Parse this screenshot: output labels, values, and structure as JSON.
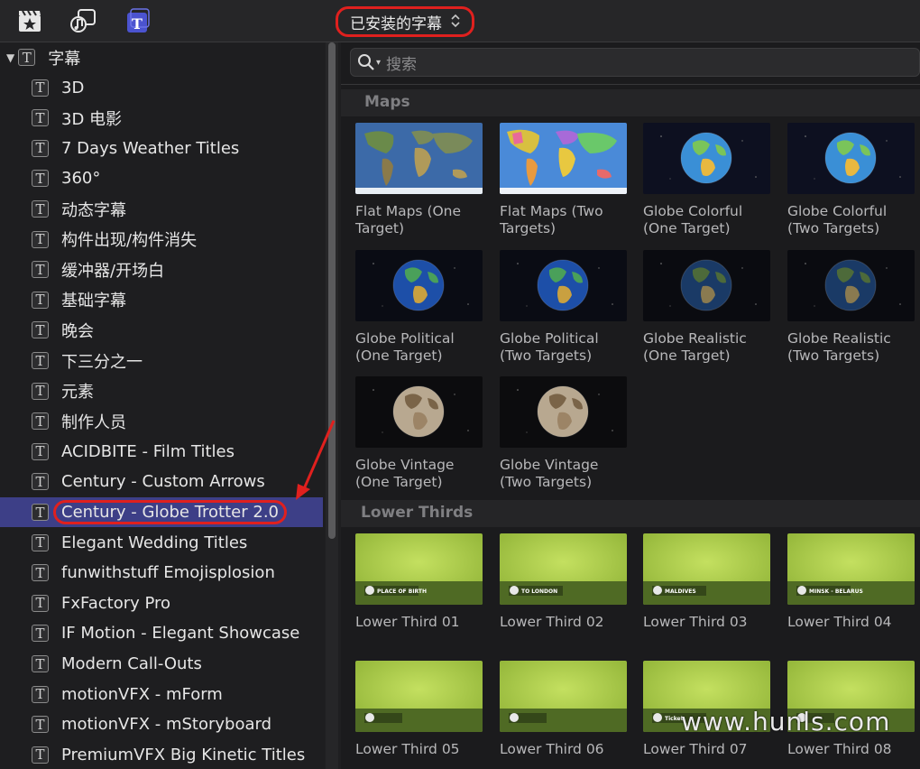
{
  "toolbar": {
    "icons": [
      "clapper-star-icon",
      "music-photo-icon",
      "titles-icon"
    ],
    "dropdown_label": "已安装的字幕",
    "dropdown_chevron": "⌃⌄"
  },
  "sidebar": {
    "root_label": "字幕",
    "items": [
      {
        "label": "3D"
      },
      {
        "label": "3D 电影"
      },
      {
        "label": "7 Days Weather Titles"
      },
      {
        "label": "360°"
      },
      {
        "label": "动态字幕"
      },
      {
        "label": "构件出现/构件消失"
      },
      {
        "label": "缓冲器/开场白"
      },
      {
        "label": "基础字幕"
      },
      {
        "label": "晚会"
      },
      {
        "label": "下三分之一"
      },
      {
        "label": "元素"
      },
      {
        "label": "制作人员"
      },
      {
        "label": "ACIDBITE - Film Titles"
      },
      {
        "label": "Century - Custom Arrows"
      },
      {
        "label": "Century - Globe Trotter 2.0",
        "selected": true
      },
      {
        "label": "Elegant Wedding Titles"
      },
      {
        "label": "funwithstuff Emojisplosion"
      },
      {
        "label": "FxFactory Pro"
      },
      {
        "label": "IF Motion - Elegant Showcase"
      },
      {
        "label": "Modern Call-Outs"
      },
      {
        "label": "motionVFX - mForm"
      },
      {
        "label": "motionVFX - mStoryboard"
      },
      {
        "label": "PremiumVFX Big Kinetic Titles"
      }
    ]
  },
  "search": {
    "placeholder": "搜索"
  },
  "sections": [
    {
      "title": "Maps",
      "tiles": [
        {
          "l1": "Flat Maps (One",
          "l2": "Target)",
          "kind": "flat1"
        },
        {
          "l1": "Flat Maps (Two",
          "l2": "Targets)",
          "kind": "flat2"
        },
        {
          "l1": "Globe Colorful",
          "l2": "(One Target)",
          "kind": "colorful"
        },
        {
          "l1": "Globe Colorful",
          "l2": "(Two Targets)",
          "kind": "colorful"
        },
        {
          "l1": "Globe Political",
          "l2": "(One Target)",
          "kind": "political"
        },
        {
          "l1": "Globe Political",
          "l2": "(Two Targets)",
          "kind": "political"
        },
        {
          "l1": "Globe Realistic",
          "l2": "(One Target)",
          "kind": "realistic"
        },
        {
          "l1": "Globe Realistic",
          "l2": "(Two Targets)",
          "kind": "realistic"
        },
        {
          "l1": "Globe Vintage",
          "l2": "(One Target)",
          "kind": "vintage"
        },
        {
          "l1": "Globe Vintage",
          "l2": "(Two Targets)",
          "kind": "vintage"
        }
      ]
    },
    {
      "title": "Lower Thirds",
      "tiles": [
        {
          "l1": "Lower Third 01",
          "tag": "PLACE OF BIRTH"
        },
        {
          "l1": "Lower Third 02",
          "tag": "TO LONDON"
        },
        {
          "l1": "Lower Third 03",
          "tag": "MALDIVES"
        },
        {
          "l1": "Lower Third 04",
          "tag": "MINSK - BELARUS"
        },
        {
          "l1": "Lower Third 05",
          "tag": ""
        },
        {
          "l1": "Lower Third 06",
          "tag": ""
        },
        {
          "l1": "Lower Third 07",
          "tag": "Ticket"
        },
        {
          "l1": "Lower Third 08",
          "tag": ""
        }
      ]
    }
  ],
  "watermark": "www.hunls.com",
  "colors": {
    "selection": "#3d3f87",
    "highlight_ring": "#e0201e",
    "lower_third_green": "#a9cc4a"
  }
}
